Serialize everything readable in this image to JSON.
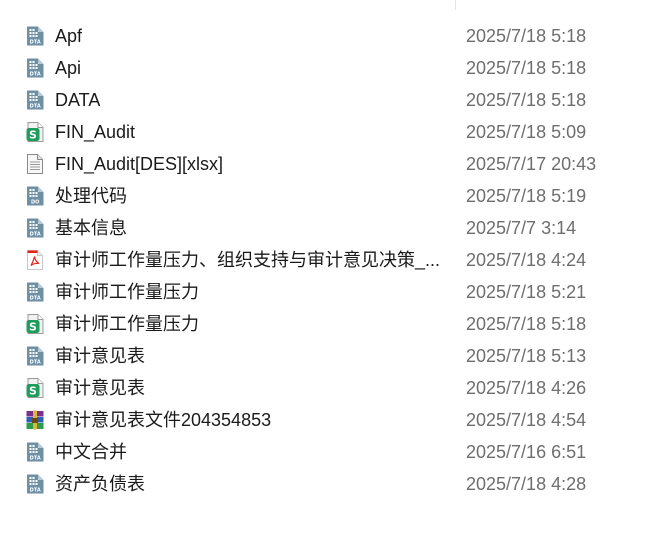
{
  "files": [
    {
      "name": "Apf",
      "modified": "2025/7/18 5:18",
      "icon": "dta-icon"
    },
    {
      "name": "Api",
      "modified": "2025/7/18 5:18",
      "icon": "dta-icon"
    },
    {
      "name": "DATA",
      "modified": "2025/7/18 5:18",
      "icon": "dta-icon"
    },
    {
      "name": "FIN_Audit",
      "modified": "2025/7/18 5:09",
      "icon": "spreadsheet-icon"
    },
    {
      "name": "FIN_Audit[DES][xlsx]",
      "modified": "2025/7/17 20:43",
      "icon": "text-file-icon"
    },
    {
      "name": "处理代码",
      "modified": "2025/7/18 5:19",
      "icon": "do-file-icon"
    },
    {
      "name": "基本信息",
      "modified": "2025/7/7 3:14",
      "icon": "dta-icon"
    },
    {
      "name": "审计师工作量压力、组织支持与审计意见决策_...",
      "modified": "2025/7/18 4:24",
      "icon": "pdf-icon"
    },
    {
      "name": "审计师工作量压力",
      "modified": "2025/7/18 5:21",
      "icon": "dta-icon"
    },
    {
      "name": "审计师工作量压力",
      "modified": "2025/7/18 5:18",
      "icon": "spreadsheet-icon"
    },
    {
      "name": "审计意见表",
      "modified": "2025/7/18 5:13",
      "icon": "dta-icon"
    },
    {
      "name": "审计意见表",
      "modified": "2025/7/18 4:26",
      "icon": "spreadsheet-icon"
    },
    {
      "name": "审计意见表文件204354853",
      "modified": "2025/7/18 4:54",
      "icon": "archive-icon"
    },
    {
      "name": "中文合并",
      "modified": "2025/7/16 6:51",
      "icon": "dta-icon"
    },
    {
      "name": "资产负债表",
      "modified": "2025/7/18 4:28",
      "icon": "dta-icon"
    }
  ]
}
